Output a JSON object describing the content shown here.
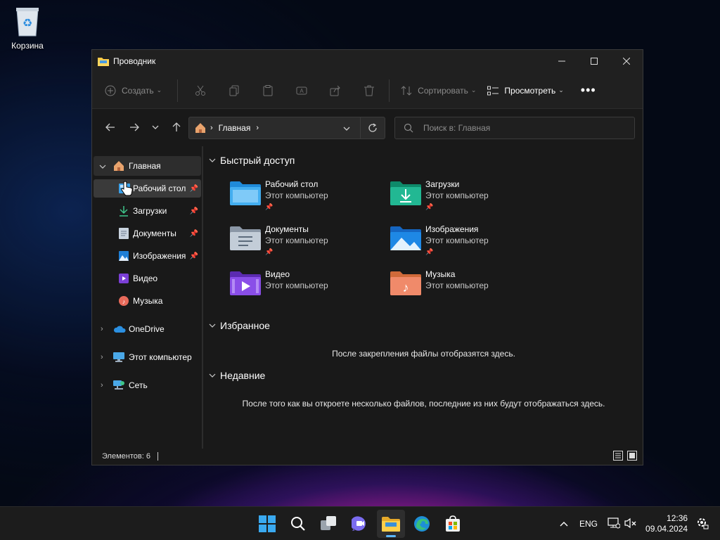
{
  "desktop": {
    "recycle_bin_label": "Корзина"
  },
  "window": {
    "title": "Проводник",
    "toolbar": {
      "create_label": "Создать",
      "sort_label": "Сортировать",
      "view_label": "Просмотреть"
    },
    "address": {
      "crumb": "Главная"
    },
    "search": {
      "placeholder": "Поиск в: Главная"
    },
    "sidebar": {
      "home": "Главная",
      "items": [
        "Рабочий стол",
        "Загрузки",
        "Документы",
        "Изображения",
        "Видео",
        "Музыка"
      ],
      "onedrive": "OneDrive",
      "this_pc": "Этот компьютер",
      "network": "Сеть"
    },
    "quick_access": {
      "title": "Быстрый доступ",
      "tiles": [
        {
          "name": "Рабочий стол",
          "sub": "Этот компьютер"
        },
        {
          "name": "Загрузки",
          "sub": "Этот компьютер"
        },
        {
          "name": "Документы",
          "sub": "Этот компьютер"
        },
        {
          "name": "Изображения",
          "sub": "Этот компьютер"
        },
        {
          "name": "Видео",
          "sub": "Этот компьютер"
        },
        {
          "name": "Музыка",
          "sub": "Этот компьютер"
        }
      ]
    },
    "favorites": {
      "title": "Избранное",
      "message": "После закрепления файлы отобразятся здесь."
    },
    "recent": {
      "title": "Недавние",
      "message": "После того как вы откроете несколько файлов, последние из них будут отображаться здесь."
    },
    "status": {
      "items_label": "Элементов: 6"
    }
  },
  "taskbar": {
    "lang": "ENG",
    "time": "12:36",
    "date": "09.04.2024"
  }
}
